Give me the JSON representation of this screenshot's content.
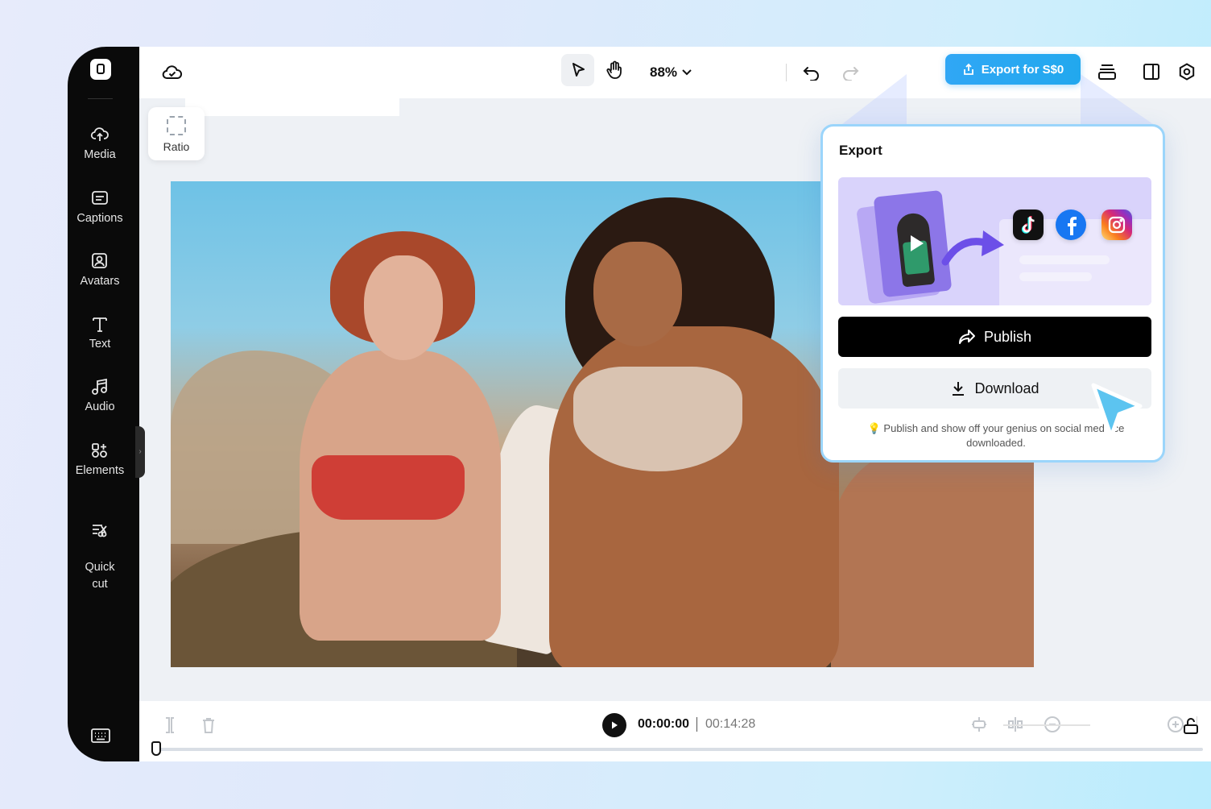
{
  "sidebar": {
    "items": [
      {
        "label": "Media",
        "icon": "media-upload-icon"
      },
      {
        "label": "Captions",
        "icon": "captions-icon"
      },
      {
        "label": "Avatars",
        "icon": "avatar-icon"
      },
      {
        "label": "Text",
        "icon": "text-icon"
      },
      {
        "label": "Audio",
        "icon": "music-note-icon"
      },
      {
        "label": "Elements",
        "icon": "elements-icon"
      },
      {
        "label": "Quick\ncut",
        "icon": "quick-cut-icon"
      }
    ]
  },
  "toolbar": {
    "zoom": "88%",
    "export_label": "Export for S$0"
  },
  "canvas": {
    "ratio_label": "Ratio"
  },
  "export_panel": {
    "title": "Export",
    "publish_label": "Publish",
    "download_label": "Download",
    "note": "Publish and show off your genius on social med     nce downloaded."
  },
  "player": {
    "current_time": "00:00:00",
    "total_time": "00:14:28"
  },
  "colors": {
    "accent": "#22a8ee",
    "sidebar_bg": "#0a0a0a",
    "panel_border": "#9bd5fb"
  }
}
